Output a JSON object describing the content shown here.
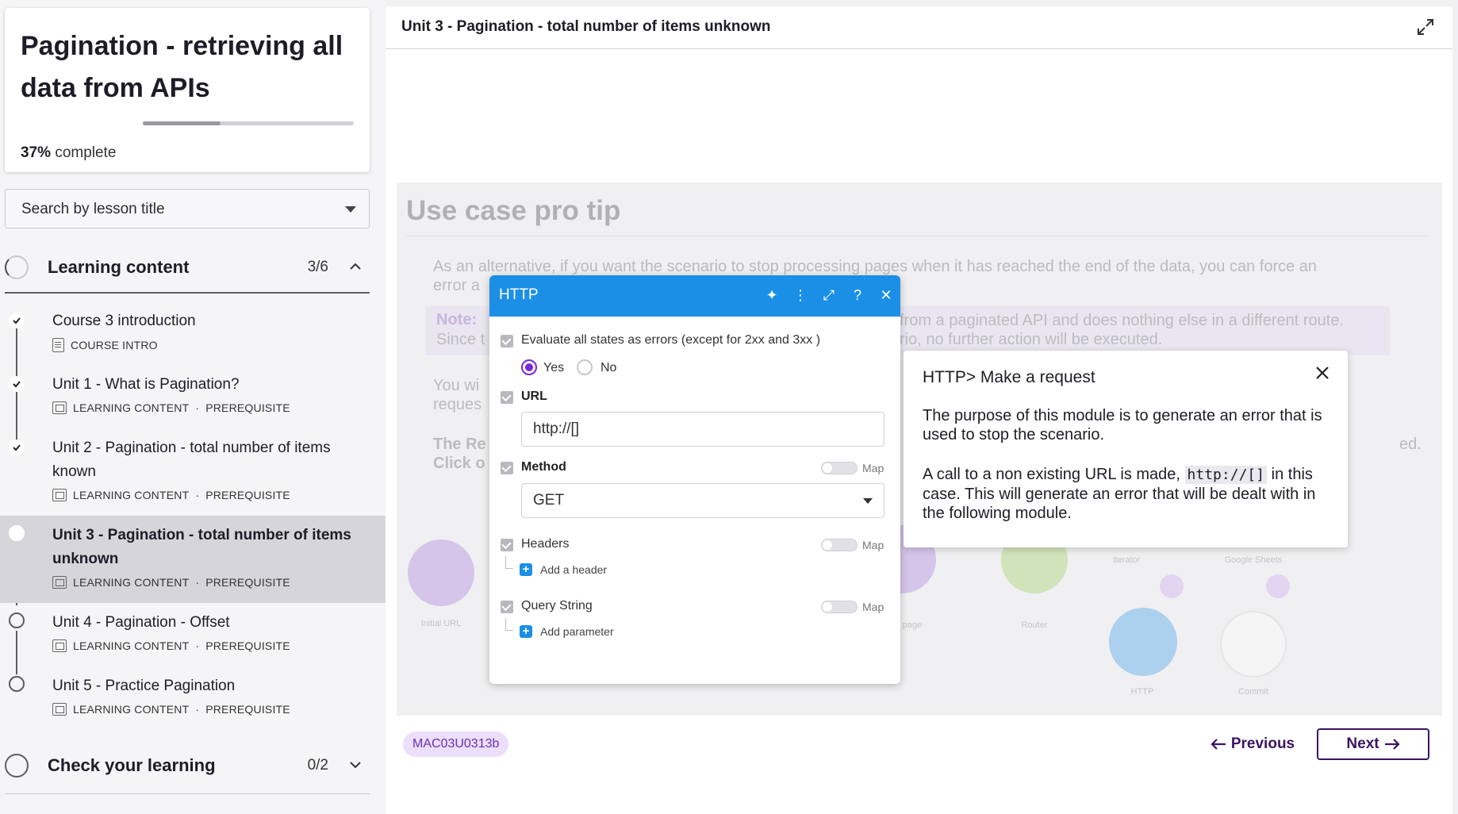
{
  "sidebar": {
    "course_title": "Pagination - retrieving all data from APIs",
    "progress_percent": 37,
    "progress_value": "37%",
    "progress_suffix": "complete",
    "search_placeholder": "Search by lesson title",
    "sections": [
      {
        "label": "Learning content",
        "count": "3/6",
        "expanded": true
      },
      {
        "label": "Check your learning",
        "count": "0/2",
        "expanded": false
      }
    ],
    "lessons": [
      {
        "title": "Course 3 introduction",
        "type": "COURSE INTRO",
        "tag": "",
        "status": "done"
      },
      {
        "title": "Unit 1 - What is Pagination?",
        "type": "LEARNING CONTENT",
        "tag": "PREREQUISITE",
        "status": "done"
      },
      {
        "title": "Unit 2 - Pagination - total number of items known",
        "type": "LEARNING CONTENT",
        "tag": "PREREQUISITE",
        "status": "done"
      },
      {
        "title": "Unit 3 - Pagination - total number of items unknown",
        "type": "LEARNING CONTENT",
        "tag": "PREREQUISITE",
        "status": "current"
      },
      {
        "title": "Unit 4 - Pagination - Offset",
        "type": "LEARNING CONTENT",
        "tag": "PREREQUISITE",
        "status": "open"
      },
      {
        "title": "Unit 5 - Practice Pagination",
        "type": "LEARNING CONTENT",
        "tag": "PREREQUISITE",
        "status": "open"
      }
    ],
    "meta_separator": "·"
  },
  "main": {
    "header_title": "Unit 3 - Pagination - total number of items unknown",
    "background": {
      "heading": "Use case pro tip",
      "para1_line1": "As an alternative, if you want the scenario to stop processing pages when it has reached the end of the data, you can force an",
      "para1_line2": "error a",
      "note_label": "Note:",
      "note_right1": "from a paginated API and does nothing else in a different route.",
      "note_left2": "Since t",
      "note_right2": "rio, no further action will be executed.",
      "para2_line1": "You wi",
      "para2_line2": "reques",
      "para3_line1": "The Re",
      "para3_line2": "Click o",
      "para3_right": "ed.",
      "flow_labels": [
        "Initial URL",
        "Next page",
        "Router",
        "Iterator",
        "Google Sheets",
        "HTTP",
        "Commit"
      ]
    },
    "http_module": {
      "title": "HTTP",
      "evaluate_label": "Evaluate all states as errors (except for 2xx and 3xx )",
      "yes_label": "Yes",
      "no_label": "No",
      "url_label": "URL",
      "url_value": "http://[]",
      "method_label": "Method",
      "method_value": "GET",
      "map_label": "Map",
      "headers_label": "Headers",
      "add_header": "Add a header",
      "query_label": "Query String",
      "add_parameter": "Add parameter"
    },
    "tooltip": {
      "title": "HTTP> Make a request",
      "para1": "The purpose of this module is to generate an error that is used to stop the scenario.",
      "para2_before": "A call to a non existing URL is made,",
      "para2_code": "http://[]",
      "para2_after": "in this case. This will generate an error that will be dealt with in the following module."
    },
    "footer": {
      "code": "MAC03U0313b",
      "previous": "Previous",
      "next": "Next"
    }
  },
  "colors": {
    "accent": "#3b1464",
    "http_blue": "#1b8fe6",
    "radio_purple": "#7a28d8",
    "active_row": "#d6d6da"
  }
}
